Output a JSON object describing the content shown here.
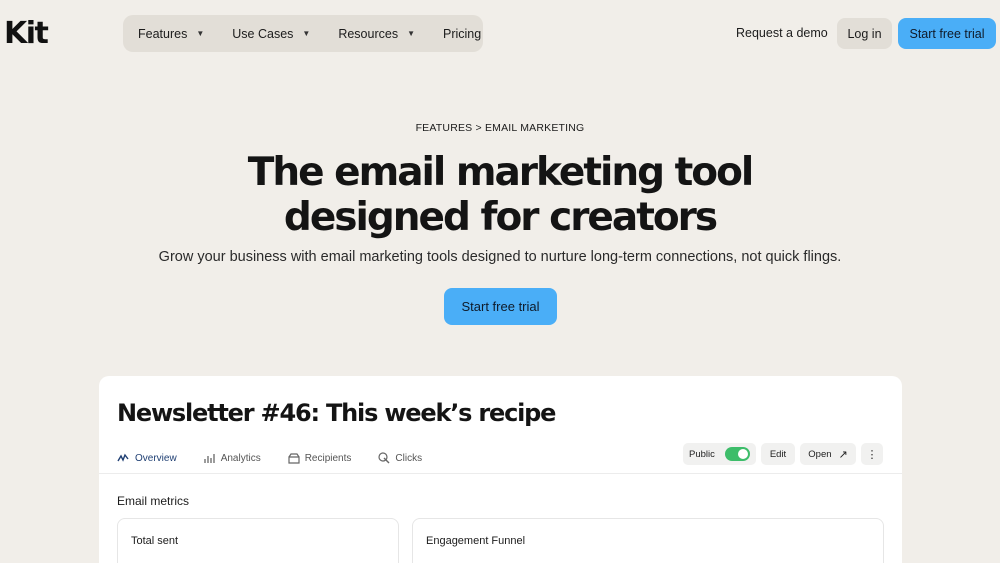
{
  "brand": {
    "logo_text": "Kit"
  },
  "nav": {
    "items": [
      {
        "label": "Features",
        "has_dropdown": true
      },
      {
        "label": "Use Cases",
        "has_dropdown": true
      },
      {
        "label": "Resources",
        "has_dropdown": true
      },
      {
        "label": "Pricing",
        "has_dropdown": false
      }
    ],
    "dropdown_glyph": "▼"
  },
  "header_actions": {
    "request_demo": "Request a demo",
    "login": "Log in",
    "start_trial": "Start free trial"
  },
  "hero": {
    "breadcrumb": "FEATURES > EMAIL MARKETING",
    "title_line1": "The email marketing tool",
    "title_line2": "designed for creators",
    "subtitle": "Grow your business with email marketing tools designed to nurture long-term connections, not quick flings.",
    "cta": "Start free trial"
  },
  "preview": {
    "title": "Newsletter #46: This week’s recipe",
    "tabs": [
      {
        "label": "Overview",
        "icon": "overview-icon",
        "active": true
      },
      {
        "label": "Analytics",
        "icon": "analytics-icon",
        "active": false
      },
      {
        "label": "Recipients",
        "icon": "recipients-icon",
        "active": false
      },
      {
        "label": "Clicks",
        "icon": "clicks-icon",
        "active": false
      }
    ],
    "actions": {
      "public_label": "Public",
      "public_enabled": true,
      "edit": "Edit",
      "open": "Open",
      "open_arrow": "↗",
      "more": "⋮"
    },
    "metrics_heading": "Email metrics",
    "metric_boxes": [
      "Total sent",
      "Engagement Funnel"
    ]
  },
  "colors": {
    "page_bg": "#f1eee9",
    "nav_bg": "#e2ded7",
    "accent_blue": "#4aaef7",
    "toggle_green": "#3dbd6a",
    "active_tab": "#1f3f73"
  }
}
